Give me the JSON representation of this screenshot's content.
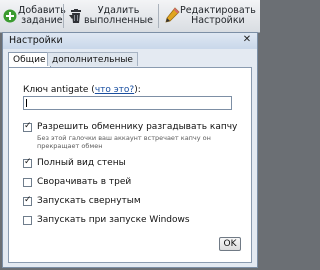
{
  "toolbar": {
    "add_task_line1": "Добавить",
    "add_task_line2": "задание",
    "delete_completed_line1": "Удалить",
    "delete_completed_line2": "выполненные",
    "edit_settings_line1": "Редактировать",
    "edit_settings_line2": "Настройки"
  },
  "dialog": {
    "title": "Настройки",
    "close_glyph": "✕",
    "tabs": [
      "Общие",
      "дополнительные"
    ],
    "antigate_label": "Ключ antigate (",
    "antigate_link": "что это?",
    "antigate_label_end": "):",
    "antigate_value": "",
    "checkboxes": [
      {
        "label": "Разрешить обменнику разгадывать капчу",
        "checked": true
      },
      {
        "label": "Полный вид стены",
        "checked": true
      },
      {
        "label": "Сворачивать в трей",
        "checked": false
      },
      {
        "label": "Запускать свернутым",
        "checked": true
      },
      {
        "label": "Запускать при запуске Windows",
        "checked": false
      }
    ],
    "hint_line1": "Без этой галочки ваш аккаунт встречает капчу он",
    "hint_line2": "прекращает обмен",
    "ok_label": "OK"
  },
  "colors": {
    "accent_link": "#1a4fa0",
    "add_icon": "#3a9b2f",
    "delete_icon": "#2f3136",
    "pencil_icon": "#e0a520"
  },
  "icons": {
    "add": "plus-icon",
    "delete": "trash-icon",
    "edit": "pencil-icon",
    "close": "close-icon"
  }
}
